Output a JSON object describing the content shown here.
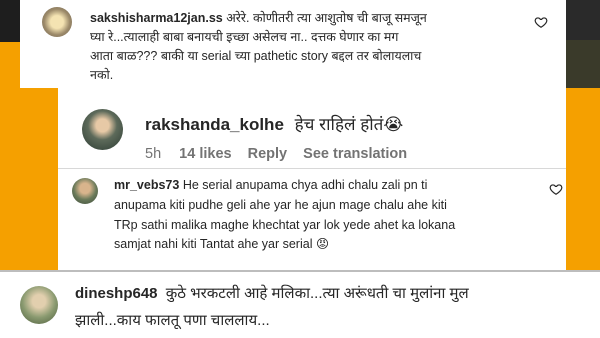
{
  "comments": [
    {
      "username": "sakshisharma12jan.ss",
      "line1": "अरेरे. कोणीतरी त्या आशुतोष ची बाजू समजून",
      "line2": "घ्या रे...त्यालाही बाबा बनायची इच्छा असेलच ना.. दत्तक घेणार का मग",
      "line3": "आता बाळ??? बाकी या serial च्या pathetic story बद्दल तर बोलायलाच",
      "line4": "नको."
    },
    {
      "username": "rakshanda_kolhe",
      "text": "हेच राहिलं होतं😭",
      "time": "5h",
      "likes": "14 likes",
      "reply": "Reply",
      "see_translation": "See translation"
    },
    {
      "username": "mr_vebs73",
      "line1": "He serial anupama chya adhi chalu zali pn ti",
      "line2": "anupama kiti pudhe geli ahe yar he ajun mage chalu ahe kiti",
      "line3": "TRp sathi malika maghe khechtat yar lok yede ahet ka lokana",
      "line4": "samjat nahi kiti Tantat ahe yar serial 😡"
    },
    {
      "username": "dineshp648",
      "line1": "कुठे भरकटली आहे मलिका...त्या अरूंधती चा मुलांना मुल",
      "line2": "झाली...काय फालतू पणा चाललाय..."
    }
  ],
  "colors": {
    "background_orange": "#f5a000",
    "background_dark": "#1e1e1e",
    "text": "#262626",
    "meta": "#737373",
    "divider": "#bdbdbd"
  },
  "icons": [
    "heart-outline-icon",
    "heart-outline-icon"
  ]
}
